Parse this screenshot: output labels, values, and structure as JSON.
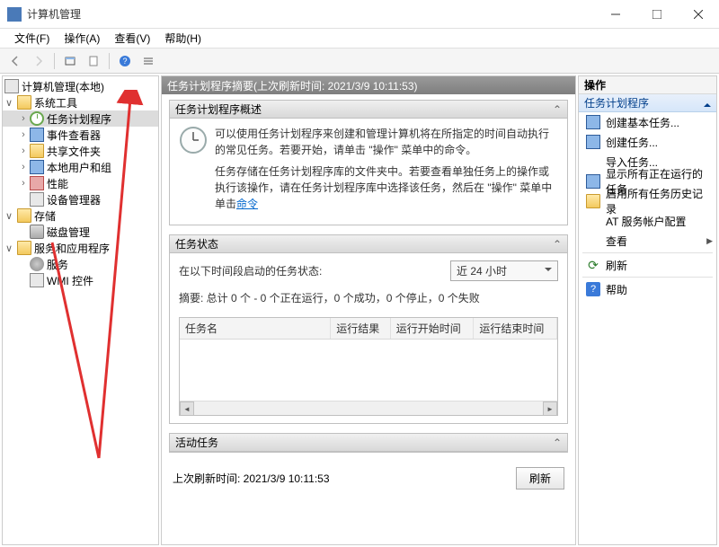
{
  "window": {
    "title": "计算机管理"
  },
  "menu": {
    "file": "文件(F)",
    "action": "操作(A)",
    "view": "查看(V)",
    "help": "帮助(H)"
  },
  "tree": {
    "root": "计算机管理(本地)",
    "n1": "系统工具",
    "n1a": "任务计划程序",
    "n1b": "事件查看器",
    "n1c": "共享文件夹",
    "n1d": "本地用户和组",
    "n1e": "性能",
    "n1f": "设备管理器",
    "n2": "存储",
    "n2a": "磁盘管理",
    "n3": "服务和应用程序",
    "n3a": "服务",
    "n3b": "WMI 控件"
  },
  "center": {
    "header": "任务计划程序摘要(上次刷新时间: 2021/3/9 10:11:53)",
    "panel1": {
      "title": "任务计划程序概述",
      "p1": "可以使用任务计划程序来创建和管理计算机将在所指定的时间自动执行的常见任务。若要开始，请单击 \"操作\" 菜单中的命令。",
      "p2a": "任务存储在任务计划程序库的文件夹中。若要查看单独任务上的操作或执行该操作，请在任务计划程序库中选择该任务，然后在 \"操作\" 菜单中单击",
      "p2b": "命令"
    },
    "panel2": {
      "title": "任务状态",
      "label": "在以下时间段启动的任务状态:",
      "combo": "近 24 小时",
      "summary": "摘要: 总计 0 个 - 0 个正在运行，0 个成功，0 个停止，0 个失败",
      "col1": "任务名",
      "col2": "运行结果",
      "col3": "运行开始时间",
      "col4": "运行结束时间"
    },
    "panel3": {
      "title": "活动任务"
    },
    "footer": {
      "text": "上次刷新时间: 2021/3/9 10:11:53",
      "btn": "刷新"
    }
  },
  "actions": {
    "header": "操作",
    "sub": "任务计划程序",
    "a1": "创建基本任务...",
    "a2": "创建任务...",
    "a3": "导入任务...",
    "a4": "显示所有正在运行的任务",
    "a5": "启用所有任务历史记录",
    "a6": "AT 服务帐户配置",
    "a7": "查看",
    "a8": "刷新",
    "a9": "帮助"
  }
}
